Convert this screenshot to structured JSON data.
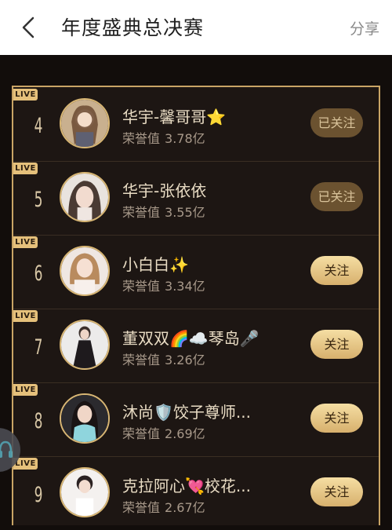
{
  "header": {
    "title": "年度盛典总决赛",
    "share_label": "分享"
  },
  "live_label": "LIVE",
  "honor_label": "荣誉值",
  "rows": [
    {
      "rank": "4",
      "name": "华宇-馨哥哥⭐",
      "honor": "3.78亿",
      "button": "已关注",
      "followed": true
    },
    {
      "rank": "5",
      "name": "华宇-张依依",
      "honor": "3.55亿",
      "button": "已关注",
      "followed": true
    },
    {
      "rank": "6",
      "name": "小白白✨",
      "honor": "3.34亿",
      "button": "关注",
      "followed": false
    },
    {
      "rank": "7",
      "name": "董双双🌈☁️琴岛🎤",
      "honor": "3.26亿",
      "button": "关注",
      "followed": false
    },
    {
      "rank": "8",
      "name": "沐尚🛡️饺子尊师...",
      "honor": "2.69亿",
      "button": "关注",
      "followed": false
    },
    {
      "rank": "9",
      "name": "克拉阿心💘校花...",
      "honor": "2.67亿",
      "button": "关注",
      "followed": false
    }
  ],
  "colors": {
    "accent": "#c9a465",
    "button_gold": "#e5c07b",
    "followed_bg": "#6b5230"
  },
  "icons": {
    "back": "chevron-left-icon",
    "float": "headphones-icon"
  }
}
